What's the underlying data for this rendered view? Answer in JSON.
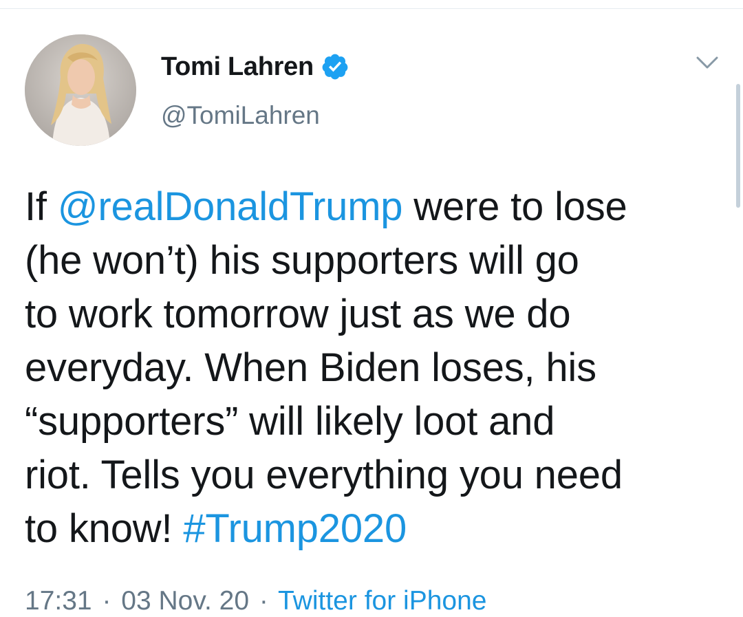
{
  "user": {
    "display_name": "Tomi Lahren",
    "handle": "@TomiLahren",
    "verified": true,
    "avatar_icon": "profile-photo"
  },
  "tweet": {
    "lines": [
      {
        "pre": "If ",
        "mention": "@realDonaldTrump",
        "post": " were to lose"
      },
      {
        "text": "(he won’t) his supporters will go"
      },
      {
        "text": "to work tomorrow just as we do"
      },
      {
        "text": "everyday. When Biden loses, his"
      },
      {
        "text": "“supporters” will likely loot and"
      },
      {
        "text": "riot. Tells you everything you need"
      },
      {
        "pre": "to know! ",
        "hashtag": "#Trump2020"
      }
    ]
  },
  "meta": {
    "time": "17:31",
    "date": "03 Nov. 20",
    "source": "Twitter for iPhone",
    "separator": "·"
  },
  "colors": {
    "link": "#1b95e0",
    "secondary_text": "#657786",
    "primary_text": "#14171a",
    "verified_badge": "#1da1f2"
  },
  "icons": {
    "verified": "verified-badge-icon",
    "caret": "chevron-down-icon"
  }
}
